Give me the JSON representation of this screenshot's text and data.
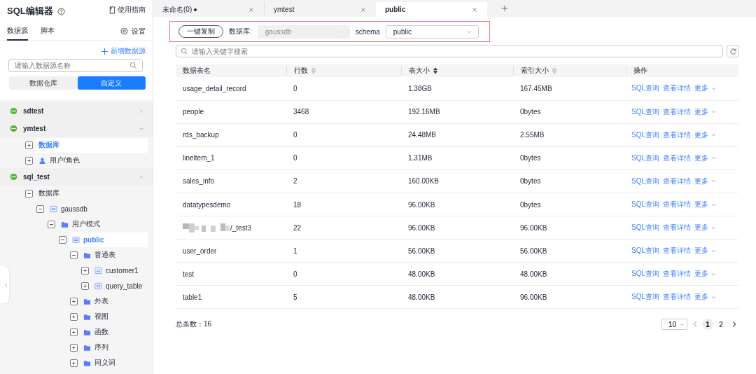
{
  "sidebar": {
    "title": "SQL编辑器",
    "guide": "使用指南",
    "tabs": [
      {
        "label": "数据源",
        "selected": true
      },
      {
        "label": "脚本",
        "selected": false
      }
    ],
    "settings": "设置",
    "add_source": "新增数据源",
    "search": {
      "placeholder": "请输入数据源名称"
    },
    "segments": [
      {
        "label": "数据仓库",
        "selected": false
      },
      {
        "label": "自定义",
        "selected": true
      }
    ],
    "tree": [
      {
        "kind": "source",
        "label": "sdtest",
        "expanded": false,
        "selected": false
      },
      {
        "kind": "source",
        "label": "ymtest",
        "expanded": true,
        "selected": false,
        "children": [
          {
            "kind": "group",
            "label": "数据库",
            "expanded": false,
            "selected": true
          },
          {
            "kind": "user",
            "label": "用户/角色",
            "expanded": false,
            "selected": false
          }
        ]
      },
      {
        "kind": "source",
        "label": "sql_test",
        "expanded": true,
        "selected": false,
        "children": [
          {
            "kind": "group",
            "label": "数据库",
            "expanded": true,
            "selected": false,
            "children": [
              {
                "kind": "database",
                "label": "gaussdb",
                "expanded": true,
                "selected": false,
                "children": [
                  {
                    "kind": "folder",
                    "label": "用户模式",
                    "expanded": true,
                    "selected": false,
                    "children": [
                      {
                        "kind": "schema",
                        "label": "public",
                        "expanded": true,
                        "selected": true,
                        "children": [
                          {
                            "kind": "folder",
                            "label": "普通表",
                            "expanded": true,
                            "selected": false,
                            "children": [
                              {
                                "kind": "table",
                                "label": "customer1",
                                "expanded": false,
                                "selected": false
                              },
                              {
                                "kind": "table",
                                "label": "query_table",
                                "expanded": false,
                                "selected": false
                              }
                            ]
                          },
                          {
                            "kind": "folder",
                            "label": "外表",
                            "expanded": false,
                            "selected": false
                          },
                          {
                            "kind": "folder",
                            "label": "视图",
                            "expanded": false,
                            "selected": false
                          },
                          {
                            "kind": "folder",
                            "label": "函数",
                            "expanded": false,
                            "selected": false
                          },
                          {
                            "kind": "folder",
                            "label": "序列",
                            "expanded": false,
                            "selected": false
                          },
                          {
                            "kind": "folder",
                            "label": "同义词",
                            "expanded": false,
                            "selected": false
                          }
                        ]
                      }
                    ]
                  }
                ]
              }
            ]
          }
        ]
      }
    ]
  },
  "editor_tabs": [
    {
      "label": "未命名(0)",
      "modified": true,
      "selected": false
    },
    {
      "label": "ymtest",
      "modified": false,
      "selected": false
    },
    {
      "label": "public",
      "modified": false,
      "selected": true
    }
  ],
  "toolbar": {
    "copy_button": "一键复制",
    "database_label": "数据库:",
    "database": {
      "value": "gaussdb",
      "disabled": true
    },
    "schema_label": "schema",
    "schema": {
      "value": "public",
      "disabled": false
    }
  },
  "search": {
    "placeholder": "请输入关键字搜索"
  },
  "table": {
    "columns": [
      {
        "label": "数据表名"
      },
      {
        "label": "行数",
        "sorted_descending": false
      },
      {
        "label": "表大小",
        "sorted_descending": true
      },
      {
        "label": "索引大小",
        "sorted_descending": false
      },
      {
        "label": "操作"
      }
    ],
    "rows": [
      {
        "cells": [
          "usage_detail_record",
          "0",
          "1.38GB",
          "167.45MB"
        ],
        "redacted": false,
        "actions": [
          "SQL查询",
          "查看详情",
          "更多"
        ]
      },
      {
        "cells": [
          "people",
          "3468",
          "192.16MB",
          "0bytes"
        ],
        "redacted": false,
        "actions": [
          "SQL查询",
          "查看详情",
          "更多"
        ]
      },
      {
        "cells": [
          "rds_backup",
          "0",
          "24.48MB",
          "2.55MB"
        ],
        "redacted": false,
        "actions": [
          "SQL查询",
          "查看详情",
          "更多"
        ]
      },
      {
        "cells": [
          "lineitem_1",
          "0",
          "1.31MB",
          "0bytes"
        ],
        "redacted": false,
        "actions": [
          "SQL查询",
          "查看详情",
          "更多"
        ]
      },
      {
        "cells": [
          "sales_info",
          "2",
          "160.00KB",
          "0bytes"
        ],
        "redacted": false,
        "actions": [
          "SQL查询",
          "查看详情",
          "更多"
        ]
      },
      {
        "cells": [
          "datatypesdemo",
          "18",
          "96.00KB",
          "0bytes"
        ],
        "redacted": false,
        "actions": [
          "SQL查询",
          "查看详情",
          "更多"
        ]
      },
      {
        "cells": [
          "/_test3",
          "22",
          "96.00KB",
          "96.00KB"
        ],
        "redacted": true,
        "actions": [
          "SQL查询",
          "查看详情",
          "更多"
        ]
      },
      {
        "cells": [
          "user_order",
          "1",
          "56.00KB",
          "56.00KB"
        ],
        "redacted": false,
        "actions": [
          "SQL查询",
          "查看详情",
          "更多"
        ]
      },
      {
        "cells": [
          "test",
          "0",
          "48.00KB",
          "48.00KB"
        ],
        "redacted": false,
        "actions": [
          "SQL查询",
          "查看详情",
          "更多"
        ]
      },
      {
        "cells": [
          "table1",
          "5",
          "48.00KB",
          "96.00KB"
        ],
        "redacted": false,
        "actions": [
          "SQL查询",
          "查看详情",
          "更多"
        ]
      }
    ]
  },
  "footer": {
    "total": "总条数：16",
    "page_size": "10",
    "pages": [
      {
        "label": "1",
        "selected": true
      },
      {
        "label": "2",
        "selected": false
      }
    ]
  }
}
